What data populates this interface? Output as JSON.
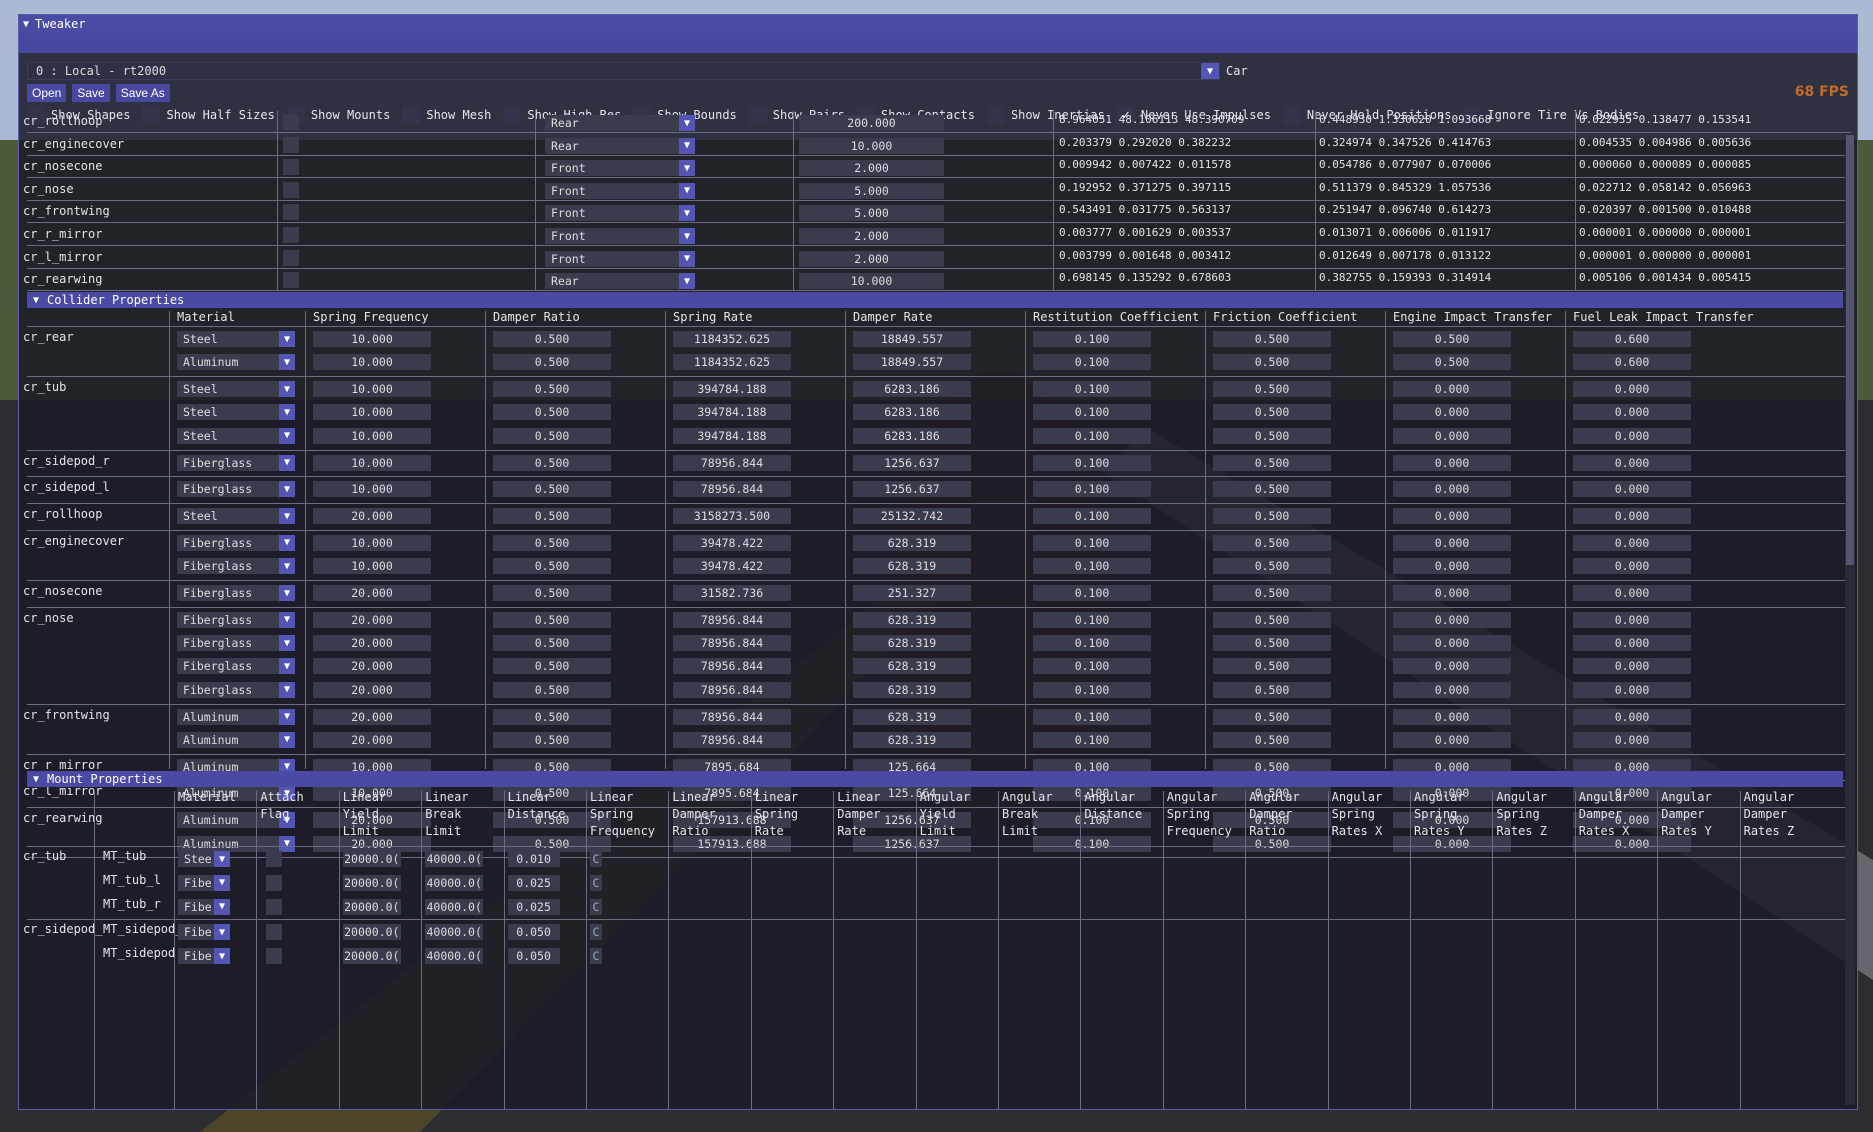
{
  "window": {
    "title": "Tweaker"
  },
  "fps_text": "68 FPS",
  "toolbar": {
    "session_value": "0 : Local  - rt2000",
    "car_label": "Car",
    "open_label": "Open",
    "save_label": "Save",
    "save_as_label": "Save As"
  },
  "options": [
    {
      "label": "Show Shapes",
      "checked": false
    },
    {
      "label": "Show Half Sizes",
      "checked": false
    },
    {
      "label": "Show Mounts",
      "checked": false
    },
    {
      "label": "Show Mesh",
      "checked": false
    },
    {
      "label": "Show High Res",
      "checked": false
    },
    {
      "label": "Show Bounds",
      "checked": false
    },
    {
      "label": "Show Pairs",
      "checked": false
    },
    {
      "label": "Show Contacts",
      "checked": false
    },
    {
      "label": "Show Inertias",
      "checked": false
    },
    {
      "label": "Never Use Impulses",
      "checked": true
    },
    {
      "label": "Never Hold Positions",
      "checked": false
    },
    {
      "label": "Ignore Tire Vs Bodies",
      "checked": false
    }
  ],
  "bodies": [
    {
      "name": "cr_rollhoop",
      "axle": "Rear",
      "mass": "200.000",
      "v1": "8.964051 48.106113 48.390709",
      "v2": "0.448930 1.330620 1.093668",
      "v3": "0.022935 0.138477 0.153541"
    },
    {
      "name": "cr_enginecover",
      "axle": "Rear",
      "mass": "10.000",
      "v1": "0.203379 0.292020 0.382232",
      "v2": "0.324974 0.347526 0.414763",
      "v3": "0.004535 0.004986 0.005636"
    },
    {
      "name": "cr_nosecone",
      "axle": "Front",
      "mass": "2.000",
      "v1": "0.009942 0.007422 0.011578",
      "v2": "0.054786 0.077907 0.070006",
      "v3": "0.000060 0.000089 0.000085"
    },
    {
      "name": "cr_nose",
      "axle": "Front",
      "mass": "5.000",
      "v1": "0.192952 0.371275 0.397115",
      "v2": "0.511379 0.845329 1.057536",
      "v3": "0.022712 0.058142 0.056963"
    },
    {
      "name": "cr_frontwing",
      "axle": "Front",
      "mass": "5.000",
      "v1": "0.543491 0.031775 0.563137",
      "v2": "0.251947 0.096740 0.614273",
      "v3": "0.020397 0.001500 0.010488"
    },
    {
      "name": "cr_r_mirror",
      "axle": "Front",
      "mass": "2.000",
      "v1": "0.003777 0.001629 0.003537",
      "v2": "0.013071 0.006006 0.011917",
      "v3": "0.000001 0.000000 0.000001"
    },
    {
      "name": "cr_l_mirror",
      "axle": "Front",
      "mass": "2.000",
      "v1": "0.003799 0.001648 0.003412",
      "v2": "0.012649 0.007178 0.013122",
      "v3": "0.000001 0.000000 0.000001"
    },
    {
      "name": "cr_rearwing",
      "axle": "Rear",
      "mass": "10.000",
      "v1": "0.698145 0.135292 0.678603",
      "v2": "0.382755 0.159393 0.314914",
      "v3": "0.005106 0.001434 0.005415"
    }
  ],
  "collider": {
    "title": "Collider Properties",
    "headers": [
      "Material",
      "Spring Frequency",
      "Damper Ratio",
      "Spring Rate",
      "Damper Rate",
      "Restitution Coefficient",
      "Friction Coefficient",
      "Engine Impact Transfer",
      "Fuel Leak Impact Transfer"
    ],
    "groups": [
      {
        "name": "cr_rear",
        "rows": [
          [
            "Steel",
            "10.000",
            "0.500",
            "1184352.625",
            "18849.557",
            "0.100",
            "0.500",
            "0.500",
            "0.600"
          ],
          [
            "Aluminum",
            "10.000",
            "0.500",
            "1184352.625",
            "18849.557",
            "0.100",
            "0.500",
            "0.500",
            "0.600"
          ]
        ]
      },
      {
        "name": "cr_tub",
        "rows": [
          [
            "Steel",
            "10.000",
            "0.500",
            "394784.188",
            "6283.186",
            "0.100",
            "0.500",
            "0.000",
            "0.000"
          ],
          [
            "Steel",
            "10.000",
            "0.500",
            "394784.188",
            "6283.186",
            "0.100",
            "0.500",
            "0.000",
            "0.000"
          ],
          [
            "Steel",
            "10.000",
            "0.500",
            "394784.188",
            "6283.186",
            "0.100",
            "0.500",
            "0.000",
            "0.000"
          ]
        ]
      },
      {
        "name": "cr_sidepod_r",
        "rows": [
          [
            "Fiberglass",
            "10.000",
            "0.500",
            "78956.844",
            "1256.637",
            "0.100",
            "0.500",
            "0.000",
            "0.000"
          ]
        ]
      },
      {
        "name": "cr_sidepod_l",
        "rows": [
          [
            "Fiberglass",
            "10.000",
            "0.500",
            "78956.844",
            "1256.637",
            "0.100",
            "0.500",
            "0.000",
            "0.000"
          ]
        ]
      },
      {
        "name": "cr_rollhoop",
        "rows": [
          [
            "Steel",
            "20.000",
            "0.500",
            "3158273.500",
            "25132.742",
            "0.100",
            "0.500",
            "0.000",
            "0.000"
          ]
        ]
      },
      {
        "name": "cr_enginecover",
        "rows": [
          [
            "Fiberglass",
            "10.000",
            "0.500",
            "39478.422",
            "628.319",
            "0.100",
            "0.500",
            "0.000",
            "0.000"
          ],
          [
            "Fiberglass",
            "10.000",
            "0.500",
            "39478.422",
            "628.319",
            "0.100",
            "0.500",
            "0.000",
            "0.000"
          ]
        ]
      },
      {
        "name": "cr_nosecone",
        "rows": [
          [
            "Fiberglass",
            "20.000",
            "0.500",
            "31582.736",
            "251.327",
            "0.100",
            "0.500",
            "0.000",
            "0.000"
          ]
        ]
      },
      {
        "name": "cr_nose",
        "rows": [
          [
            "Fiberglass",
            "20.000",
            "0.500",
            "78956.844",
            "628.319",
            "0.100",
            "0.500",
            "0.000",
            "0.000"
          ],
          [
            "Fiberglass",
            "20.000",
            "0.500",
            "78956.844",
            "628.319",
            "0.100",
            "0.500",
            "0.000",
            "0.000"
          ],
          [
            "Fiberglass",
            "20.000",
            "0.500",
            "78956.844",
            "628.319",
            "0.100",
            "0.500",
            "0.000",
            "0.000"
          ],
          [
            "Fiberglass",
            "20.000",
            "0.500",
            "78956.844",
            "628.319",
            "0.100",
            "0.500",
            "0.000",
            "0.000"
          ]
        ]
      },
      {
        "name": "cr_frontwing",
        "rows": [
          [
            "Aluminum",
            "20.000",
            "0.500",
            "78956.844",
            "628.319",
            "0.100",
            "0.500",
            "0.000",
            "0.000"
          ],
          [
            "Aluminum",
            "20.000",
            "0.500",
            "78956.844",
            "628.319",
            "0.100",
            "0.500",
            "0.000",
            "0.000"
          ]
        ]
      },
      {
        "name": "cr_r_mirror",
        "rows": [
          [
            "Aluminum",
            "10.000",
            "0.500",
            "7895.684",
            "125.664",
            "0.100",
            "0.500",
            "0.000",
            "0.000"
          ]
        ]
      },
      {
        "name": "cr_l_mirror",
        "rows": [
          [
            "Aluminum",
            "10.000",
            "0.500",
            "7895.684",
            "125.664",
            "0.100",
            "0.500",
            "0.000",
            "0.000"
          ]
        ]
      },
      {
        "name": "cr_rearwing",
        "rows": [
          [
            "Aluminum",
            "20.000",
            "0.500",
            "157913.688",
            "1256.637",
            "0.100",
            "0.500",
            "0.000",
            "0.000"
          ],
          [
            "Aluminum",
            "20.000",
            "0.500",
            "157913.688",
            "1256.637",
            "0.100",
            "0.500",
            "0.000",
            "0.000"
          ]
        ]
      }
    ]
  },
  "mount": {
    "title": "Mount Properties",
    "headers": [
      "Material",
      "Attach\nFlag",
      "Linear\nYield\nLimit",
      "Linear\nBreak\nLimit",
      "Linear\nDistance",
      "Linear\nSpring\nFrequency",
      "Linear\nDamper\nRatio",
      "Linear\nSpring\nRate",
      "Linear\nDamper\nRate",
      "Angular\nYield\nLimit",
      "Angular\nBreak\nLimit",
      "Angular\nDistance",
      "Angular\nSpring\nFrequency",
      "Angular\nDamper\nRatio",
      "Angular\nSpring\nRates X",
      "Angular\nSpring\nRates Y",
      "Angular\nSpring\nRates Z",
      "Angular\nDamper\nRates X",
      "Angular\nDamper\nRates Y",
      "Angular\nDamper\nRates Z"
    ],
    "rows": [
      {
        "body": "cr_tub",
        "mount": "MT_tub",
        "material": "Stee",
        "yield": "20000.0(",
        "break": "40000.0(",
        "distance": "0.010",
        "extra": "C"
      },
      {
        "body": "",
        "mount": "MT_tub_l",
        "material": "Fibe",
        "yield": "20000.0(",
        "break": "40000.0(",
        "distance": "0.025",
        "extra": "C"
      },
      {
        "body": "",
        "mount": "MT_tub_r",
        "material": "Fibe",
        "yield": "20000.0(",
        "break": "40000.0(",
        "distance": "0.025",
        "extra": "C"
      },
      {
        "body": "cr_sidepod_",
        "mount": "MT_sidepod_",
        "material": "Fibe",
        "yield": "20000.0(",
        "break": "40000.0(",
        "distance": "0.050",
        "extra": "C"
      },
      {
        "body": "",
        "mount": "MT_sidepod",
        "material": "Fibe",
        "yield": "20000.0(",
        "break": "40000.0(",
        "distance": "0.050",
        "extra": "C"
      }
    ]
  }
}
